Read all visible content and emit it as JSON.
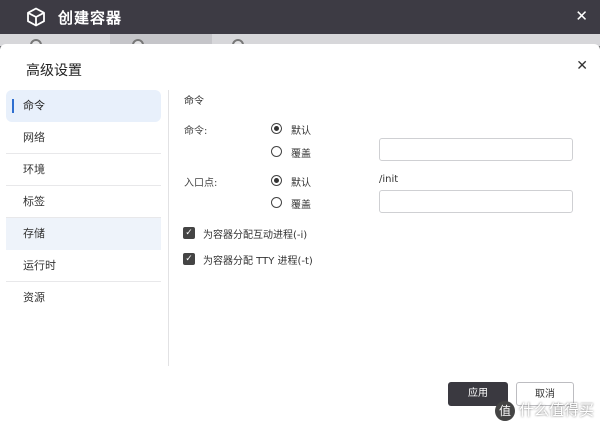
{
  "window": {
    "title": "创建容器",
    "close_glyph": "✕"
  },
  "dialog": {
    "title": "高级设置",
    "close_glyph": "✕"
  },
  "nav": {
    "items": [
      {
        "label": "命令"
      },
      {
        "label": "网络"
      },
      {
        "label": "环境"
      },
      {
        "label": "标签"
      },
      {
        "label": "存储"
      },
      {
        "label": "运行时"
      },
      {
        "label": "资源"
      }
    ]
  },
  "command": {
    "section_title": "命令",
    "cmd_label": "命令:",
    "cmd_default": "默认",
    "cmd_override": "覆盖",
    "entry_label": "入口点:",
    "entry_default": "默认",
    "entry_override": "覆盖",
    "entry_default_value": "/init",
    "cmd_input_value": "",
    "entry_input_value": ""
  },
  "options": [
    {
      "label": "为容器分配互动进程(-i)",
      "checked": true
    },
    {
      "label": "为容器分配 TTY 进程(-t)",
      "checked": true
    }
  ],
  "buttons": {
    "apply": "应用",
    "cancel": "取消"
  },
  "watermark": {
    "text": "什么值得买",
    "logo_glyph": "值"
  },
  "icons": {
    "app": "cube-icon",
    "check": "✓"
  }
}
